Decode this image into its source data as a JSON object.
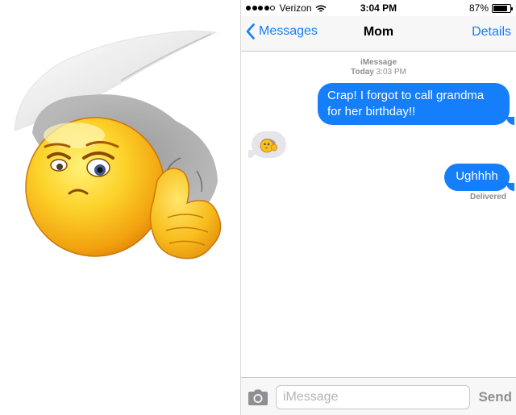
{
  "status_bar": {
    "carrier": "Verizon",
    "time": "3:04 PM",
    "battery": "87%",
    "battery_level": 0.87,
    "signal_bars_filled": 4,
    "signal_bars_total": 5
  },
  "nav": {
    "back_label": "Messages",
    "title": "Mom",
    "details_label": "Details"
  },
  "thread": {
    "service": "iMessage",
    "day": "Today",
    "time": "3:03 PM",
    "messages": [
      {
        "direction": "outgoing",
        "text": "Crap! I forgot to call grandma for her birthday!!"
      },
      {
        "direction": "incoming",
        "sticker": "facepalm-emoji-sticker"
      },
      {
        "direction": "outgoing",
        "text": "Ughhhh"
      }
    ],
    "delivered_label": "Delivered"
  },
  "input_bar": {
    "placeholder": "iMessage",
    "send_label": "Send"
  },
  "icons": {
    "back": "chevron-left-icon",
    "camera": "camera-icon",
    "wifi": "wifi-icon",
    "battery": "battery-icon"
  },
  "colors": {
    "accent": "#147efb",
    "incoming_bubble": "#e5e5ea",
    "meta_text": "#8e8e93",
    "emoji_yellow": "#f5b81c"
  }
}
